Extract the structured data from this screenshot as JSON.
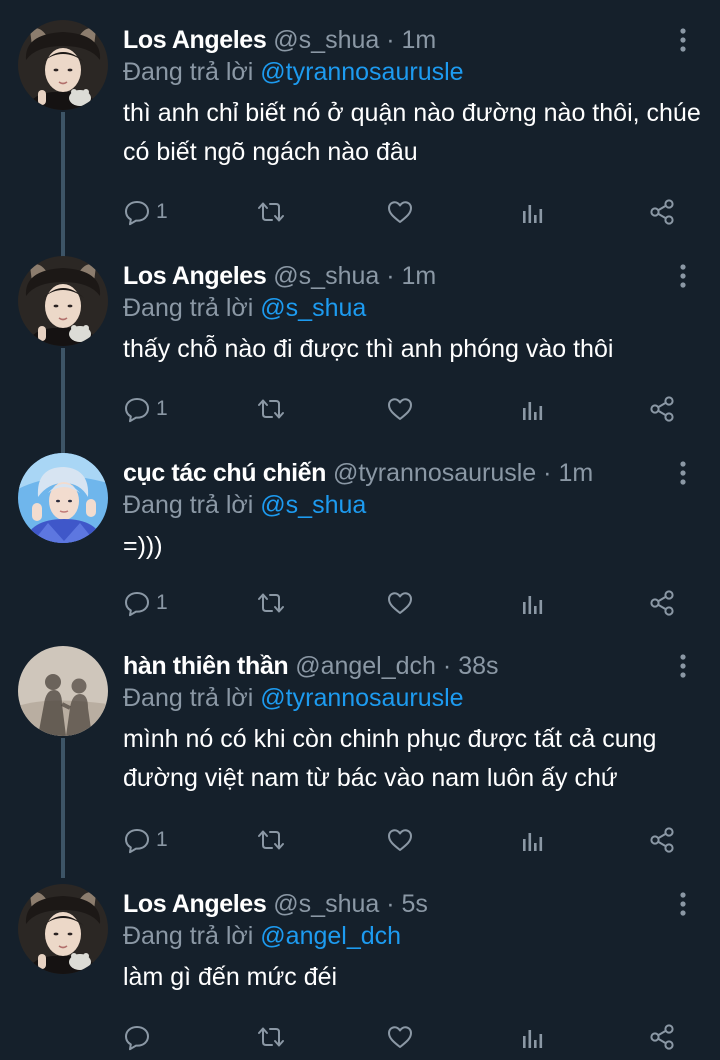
{
  "reply_prefix": "Đang trả lời",
  "colors": {
    "background": "#15202b",
    "text": "#ffffff",
    "secondary": "#8b98a5",
    "link": "#1d9bf0",
    "thread_line": "#3d5466"
  },
  "tweets": [
    {
      "display_name": "Los Angeles",
      "handle": "@s_shua",
      "separator": "·",
      "time": "1m",
      "reply_to": "@tyrannosaurusle",
      "text": "thì anh chỉ biết nó ở quận nào đường nào thôi, chúe có biết ngõ ngách nào đâu",
      "reply_count": "1",
      "avatar": "los-angeles-avatar"
    },
    {
      "display_name": "Los Angeles",
      "handle": "@s_shua",
      "separator": "·",
      "time": "1m",
      "reply_to": "@s_shua",
      "text": "thấy chỗ nào đi được thì anh phóng vào thôi",
      "reply_count": "1",
      "avatar": "los-angeles-avatar"
    },
    {
      "display_name": "cục tác chú chiến",
      "handle": "@tyrannosaurusle",
      "separator": "·",
      "time": "1m",
      "reply_to": "@s_shua",
      "text": "=)))",
      "reply_count": "1",
      "avatar": "blue-portrait-avatar"
    },
    {
      "display_name": "hàn thiên thần",
      "handle": "@angel_dch",
      "separator": "·",
      "time": "38s",
      "reply_to": "@tyrannosaurusle",
      "text": "mình nó có khi còn chinh phục được tất cả cung đường việt nam từ bác vào nam luôn ấy chứ",
      "reply_count": "1",
      "avatar": "shadow-avatar"
    },
    {
      "display_name": "Los Angeles",
      "handle": "@s_shua",
      "separator": "·",
      "time": "5s",
      "reply_to": "@angel_dch",
      "text": "làm gì đến mức đéi",
      "reply_count": "",
      "avatar": "los-angeles-avatar"
    }
  ]
}
